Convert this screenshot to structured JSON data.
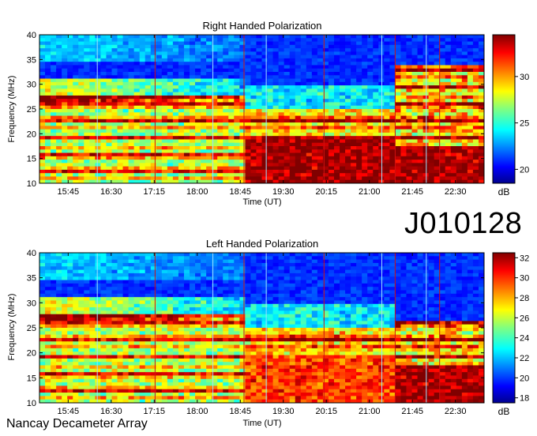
{
  "figure_id": "J010128",
  "footer": "Nancay Decameter Array",
  "chart_data": [
    {
      "type": "heatmap",
      "title": "Right Handed Polarization",
      "xlabel": "Time (UT)",
      "ylabel": "Frequency (MHz)",
      "x_ticks": [
        "15:45",
        "16:30",
        "17:15",
        "18:00",
        "18:45",
        "19:30",
        "20:15",
        "21:00",
        "21:45",
        "22:30"
      ],
      "y_ticks": [
        10,
        15,
        20,
        25,
        30,
        35,
        40
      ],
      "ylim": [
        10,
        40
      ],
      "xlim": [
        "15:15",
        "23:00"
      ],
      "colorbar": {
        "label": "dB",
        "ticks": [
          20,
          25,
          30
        ],
        "range": [
          18.5,
          34.5
        ]
      },
      "colormap": "jet"
    },
    {
      "type": "heatmap",
      "title": "Left Handed Polarization",
      "xlabel": "Time (UT)",
      "ylabel": "Frequency (MHz)",
      "x_ticks": [
        "15:45",
        "16:30",
        "17:15",
        "18:00",
        "18:45",
        "19:30",
        "20:15",
        "21:00",
        "21:45",
        "22:30"
      ],
      "y_ticks": [
        10,
        15,
        20,
        25,
        30,
        35,
        40
      ],
      "ylim": [
        10,
        40
      ],
      "xlim": [
        "15:15",
        "23:00"
      ],
      "colorbar": {
        "label": "dB",
        "ticks": [
          18,
          20,
          22,
          24,
          26,
          28,
          30,
          32
        ],
        "range": [
          17.5,
          32.5
        ]
      },
      "colormap": "jet"
    }
  ]
}
